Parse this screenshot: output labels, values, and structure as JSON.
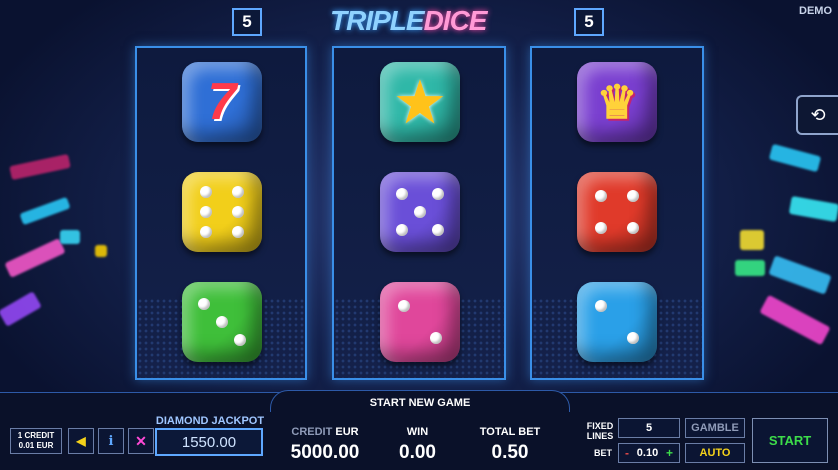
{
  "header": {
    "title_part1": "TRIPLE",
    "title_part2": "DICE",
    "demo": "DEMO",
    "lines_left": "5",
    "lines_right": "5"
  },
  "reels": [
    {
      "symbols": [
        {
          "kind": "seven",
          "color": "#2f6fd6",
          "glyph": "7"
        },
        {
          "kind": "die",
          "color": "#f2cf1a",
          "pips": 6
        },
        {
          "kind": "die",
          "color": "#3fbf3a",
          "pips": 3
        }
      ]
    },
    {
      "symbols": [
        {
          "kind": "star",
          "color": "#2fb8a8",
          "glyph": "★"
        },
        {
          "kind": "die",
          "color": "#6a4fd8",
          "pips": 5
        },
        {
          "kind": "die",
          "color": "#e0479b",
          "pips": 2
        }
      ]
    },
    {
      "symbols": [
        {
          "kind": "jester",
          "color": "#7a3fd0",
          "glyph": "♛"
        },
        {
          "kind": "die",
          "color": "#e03a2a",
          "pips": 4
        },
        {
          "kind": "die",
          "color": "#2aa0e8",
          "pips": 2
        }
      ]
    }
  ],
  "footer": {
    "denomination_line1": "1 CREDIT",
    "denomination_line2": "0.01 EUR",
    "sound_icon": "speaker-icon",
    "info_icon": "info-icon",
    "fullscreen_icon": "fullscreen-icon",
    "jackpot_label": "DIAMOND JACKPOT",
    "jackpot_value": "1550.00",
    "start_new_game": "START NEW GAME",
    "credit_label_dim": "CREDIT",
    "credit_label_unit": "EUR",
    "credit_value": "5000.00",
    "win_label": "WIN",
    "win_value": "0.00",
    "total_bet_label": "TOTAL BET",
    "total_bet_value": "0.50",
    "fixed_lines_label1": "FIXED",
    "fixed_lines_label2": "LINES",
    "fixed_lines_value": "5",
    "bet_label": "BET",
    "bet_minus": "-",
    "bet_value": "0.10",
    "bet_plus": "+",
    "gamble": "GAMBLE",
    "auto": "AUTO",
    "start": "START",
    "history_icon": "history-icon"
  },
  "colors": {
    "accent": "#3a8fe8",
    "start_green": "#3ddc4a",
    "auto_yellow": "#f5d21a",
    "plus_green": "#3ddc4a",
    "minus_red": "#e64a4a"
  }
}
